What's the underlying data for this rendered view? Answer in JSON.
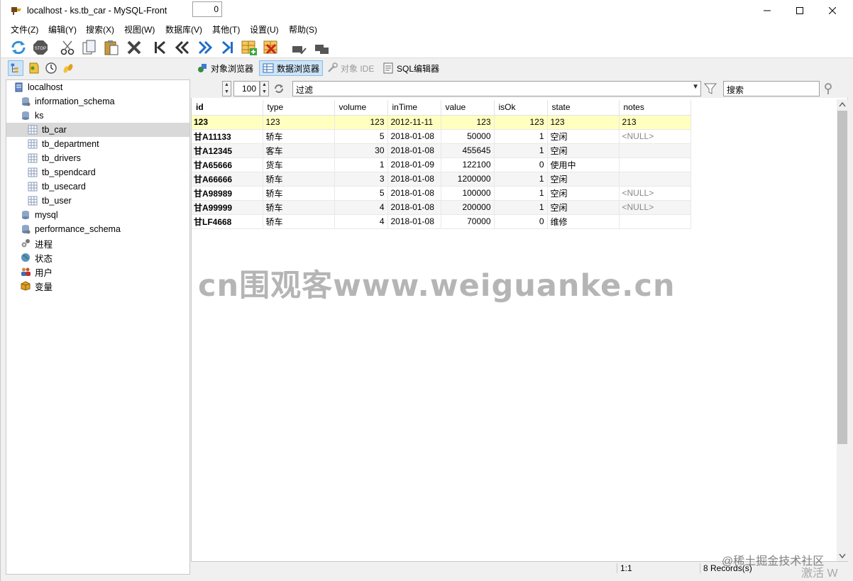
{
  "window": {
    "title": "localhost - ks.tb_car - MySQL-Front"
  },
  "menu": [
    "文件(Z)",
    "编辑(Y)",
    "搜索(X)",
    "视图(W)",
    "数据库(V)",
    "其他(T)",
    "设置(U)",
    "帮助(S)"
  ],
  "tabs": [
    "对象浏览器",
    "数据浏览器",
    "对象 IDE",
    "SQL编辑器"
  ],
  "tree": {
    "root": "localhost",
    "dbs": [
      "information_schema",
      "ks"
    ],
    "tables": [
      "tb_car",
      "tb_department",
      "tb_drivers",
      "tb_spendcard",
      "tb_usecard",
      "tb_user"
    ],
    "other_dbs": [
      "mysql",
      "performance_schema"
    ],
    "nodes": [
      "进程",
      "状态",
      "用户",
      "变量"
    ]
  },
  "filter": {
    "offset": "0",
    "limit": "100",
    "placeholder": "过滤",
    "search_placeholder": "搜索"
  },
  "grid": {
    "columns": [
      "id",
      "type",
      "volume",
      "inTime",
      "value",
      "isOk",
      "state",
      "notes"
    ],
    "rows": [
      [
        "123",
        "123",
        "123",
        "2012-11-11",
        "123",
        "123",
        "123",
        "213"
      ],
      [
        "甘A11133",
        "轿车",
        "5",
        "2018-01-08",
        "50000",
        "1",
        "空闲",
        "<NULL>"
      ],
      [
        "甘A12345",
        "客车",
        "30",
        "2018-01-08",
        "455645",
        "1",
        "空闲",
        ""
      ],
      [
        "甘A65666",
        "货车",
        "1",
        "2018-01-09",
        "122100",
        "0",
        "使用中",
        ""
      ],
      [
        "甘A66666",
        "轿车",
        "3",
        "2018-01-08",
        "1200000",
        "1",
        "空闲",
        ""
      ],
      [
        "甘A98989",
        "轿车",
        "5",
        "2018-01-08",
        "100000",
        "1",
        "空闲",
        "<NULL>"
      ],
      [
        "甘A99999",
        "轿车",
        "4",
        "2018-01-08",
        "200000",
        "1",
        "空闲",
        "<NULL>"
      ],
      [
        "甘LF4668",
        "轿车",
        "4",
        "2018-01-08",
        "70000",
        "0",
        "维修",
        ""
      ]
    ]
  },
  "status": {
    "position": "1:1",
    "records": "8 Records(s)"
  },
  "overlay": {
    "watermark": "cn围观客www.weiguanke.cn",
    "credit": "@稀土掘金技术社区",
    "activate": "激活 W"
  }
}
